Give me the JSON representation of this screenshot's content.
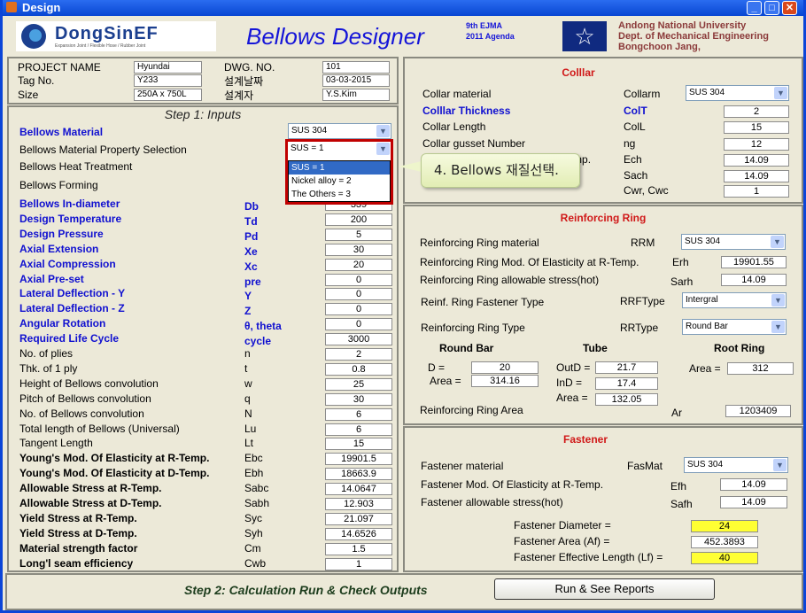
{
  "window": {
    "title": "Design",
    "icon": "matlab-icon",
    "controls": [
      "minimize",
      "maximize",
      "close"
    ]
  },
  "header": {
    "logo_text": "DongSinEF",
    "logo_sub": "Expansion Joint / Flexible Hose / Rubber Joint",
    "app_title": "Bellows  Designer",
    "ejma_line1": "9th EJMA",
    "ejma_line2": "2011 Agenda",
    "univ_line1": "Andong National University",
    "univ_line2": "Dept. of Mechanical Engineering",
    "univ_line3": "Bongchoon Jang,"
  },
  "project": {
    "name_label": "PROJECT NAME",
    "name_value": "Hyundai",
    "tag_label": "Tag No.",
    "tag_value": "Y233",
    "size_label": "Size",
    "size_value": "250A x 750L",
    "dwg_label": "DWG. NO.",
    "dwg_value": "101",
    "date_label": "설계날짜",
    "date_value": "03-03-2015",
    "designer_label": "설계자",
    "designer_value": "Y.S.Kim"
  },
  "step1": {
    "title": "Step 1: Inputs",
    "material_label": "Bellows  Material",
    "material_value": "SUS 304",
    "property_label": "Bellows  Material Property Selection",
    "property_value": "SUS = 1",
    "property_options": [
      "SUS = 1",
      "Nickel alloy = 2",
      "The Others = 3"
    ],
    "heat_label": "Bellows  Heat Treatment",
    "forming_label": "Bellows  Forming",
    "rows": [
      {
        "label": "Bellows  In-diameter",
        "sym": "Db",
        "value": "339",
        "style": "blue"
      },
      {
        "label": "Design Temperature",
        "sym": "Td",
        "value": "200",
        "style": "blue"
      },
      {
        "label": "Design Pressure",
        "sym": "Pd",
        "value": "5",
        "style": "blue"
      },
      {
        "label": "Axial Extension",
        "sym": "Xe",
        "value": "30",
        "style": "blue"
      },
      {
        "label": "Axial Compression",
        "sym": "Xc",
        "value": "20",
        "style": "blue"
      },
      {
        "label": "Axial Pre-set",
        "sym": "pre",
        "value": "0",
        "style": "blue"
      },
      {
        "label": "Lateral Deflection - Y",
        "sym": "Y",
        "value": "0",
        "style": "blue"
      },
      {
        "label": "Lateral Deflection - Z",
        "sym": "Z",
        "value": "0",
        "style": "blue"
      },
      {
        "label": "Angular Rotation",
        "sym": "θ, theta",
        "value": "0",
        "style": "blue"
      },
      {
        "label": "Required Life Cycle",
        "sym": "cycle",
        "value": "3000",
        "style": "blue"
      },
      {
        "label": "No. of plies",
        "sym": "n",
        "value": "2",
        "style": "normal"
      },
      {
        "label": "Thk. of 1 ply",
        "sym": "t",
        "value": "0.8",
        "style": "normal"
      },
      {
        "label": "Height of Bellows convolution",
        "sym": "w",
        "value": "25",
        "style": "normal"
      },
      {
        "label": "Pitch of Bellows convolution",
        "sym": "q",
        "value": "30",
        "style": "normal"
      },
      {
        "label": "No. of Bellows convolution",
        "sym": "N",
        "value": "6",
        "style": "normal"
      },
      {
        "label": "Total length of Bellows (Universal)",
        "sym": "Lu",
        "value": "6",
        "style": "normal"
      },
      {
        "label": "Tangent Length",
        "sym": "Lt",
        "value": "15",
        "style": "normal"
      },
      {
        "label": "Young's Mod. Of Elasticity at R-Temp.",
        "sym": "Ebc",
        "value": "19901.5",
        "style": "bold"
      },
      {
        "label": "Young's Mod. Of Elasticity at D-Temp.",
        "sym": "Ebh",
        "value": "18663.9",
        "style": "bold"
      },
      {
        "label": "Allowable Stress at R-Temp.",
        "sym": "Sabc",
        "value": "14.0647",
        "style": "bold"
      },
      {
        "label": "Allowable Stress at D-Temp.",
        "sym": "Sabh",
        "value": "12.903",
        "style": "bold"
      },
      {
        "label": "Yield Stress at R-Temp.",
        "sym": "Syc",
        "value": "21.097",
        "style": "bold"
      },
      {
        "label": "Yield Stress at D-Temp.",
        "sym": "Syh",
        "value": "14.6526",
        "style": "bold"
      },
      {
        "label": "Material strength factor",
        "sym": "Cm",
        "value": "1.5",
        "style": "bold"
      },
      {
        "label": "Long'l seam efficiency",
        "sym": "Cwb",
        "value": "1",
        "style": "bold"
      }
    ]
  },
  "callout": {
    "text": "4. Bellows 재질선택."
  },
  "collar": {
    "title": "Colllar",
    "rows": [
      {
        "label": "Collar  material",
        "sym": "Collarm",
        "value": "SUS 304",
        "style": "normal",
        "type": "select"
      },
      {
        "label": "Colllar Thickness",
        "sym": "ColT",
        "value": "2",
        "style": "blue"
      },
      {
        "label": "Collar Length",
        "sym": "ColL",
        "value": "15",
        "style": "normal"
      },
      {
        "label": "Collar gusset Number",
        "sym": "ng",
        "value": "12",
        "style": "normal"
      },
      {
        "label": "Collar Mod. Of Elasticity at R-Temp.",
        "sym": "Ech",
        "value": "14.09",
        "style": "normal"
      },
      {
        "label": "",
        "sym": "Sach",
        "value": "14.09",
        "style": "normal"
      },
      {
        "label": "",
        "sym": "Cwr, Cwc",
        "value": "1",
        "style": "normal"
      }
    ]
  },
  "ring": {
    "title": "Reinforcing Ring",
    "material_label": "Reinforcing Ring  material",
    "material_sym": "RRM",
    "material_value": "SUS 304",
    "mod_label": "Reinforcing Ring Mod. Of Elasticity at R-Temp.",
    "mod_sym": "Erh",
    "mod_value": "19901.55",
    "stress_label": "Reinforcing Ring allowable stress(hot)",
    "stress_sym": "Sarh",
    "stress_value": "14.09",
    "fastener_label": "Reinf. Ring Fastener  Type",
    "fastener_sym": "RRFType",
    "fastener_value": "Intergral",
    "type_label": "Reinforcing Ring  Type",
    "type_sym": "RRType",
    "type_value": "Round Bar",
    "round_bar": {
      "title": "Round Bar",
      "d_label": "D =",
      "d_value": "20",
      "area_label": "Area =",
      "area_value": "314.16"
    },
    "tube": {
      "title": "Tube",
      "outd_label": "OutD =",
      "outd_value": "21.7",
      "ind_label": "InD =",
      "ind_value": "17.4",
      "area_label": "Area =",
      "area_value": "132.05"
    },
    "root_ring": {
      "title": "Root Ring",
      "area_label": "Area =",
      "area_value": "312"
    },
    "area_label": "Reinforcing Ring Area",
    "area_sym": "Ar",
    "area_value": "1203409"
  },
  "fastener": {
    "title": "Fastener",
    "material_label": "Fastener  material",
    "material_sym": "FasMat",
    "material_value": "SUS 304",
    "mod_label": "Fastener Mod. Of Elasticity at R-Temp.",
    "mod_sym": "Efh",
    "mod_value": "14.09",
    "stress_label": "Fastener allowable stress(hot)",
    "stress_sym": "Safh",
    "stress_value": "14.09",
    "diam_label": "Fastener Diameter =",
    "diam_value": "24",
    "area_label": "Fastener Area (Af) =",
    "area_value": "452.3893",
    "length_label": "Fastener Effective Length (Lf) =",
    "length_value": "40"
  },
  "step2": {
    "title": "Step 2: Calculation Run & Check Outputs",
    "run_button": "Run & See Reports"
  },
  "colors": {
    "accent_blue": "#1010d0",
    "section_red": "#d01818",
    "highlight_yellow": "#ffff33",
    "callout_bg": "#eef5cc",
    "dropdown_highlight": "#316ac5",
    "annotation_red": "#c00000"
  }
}
